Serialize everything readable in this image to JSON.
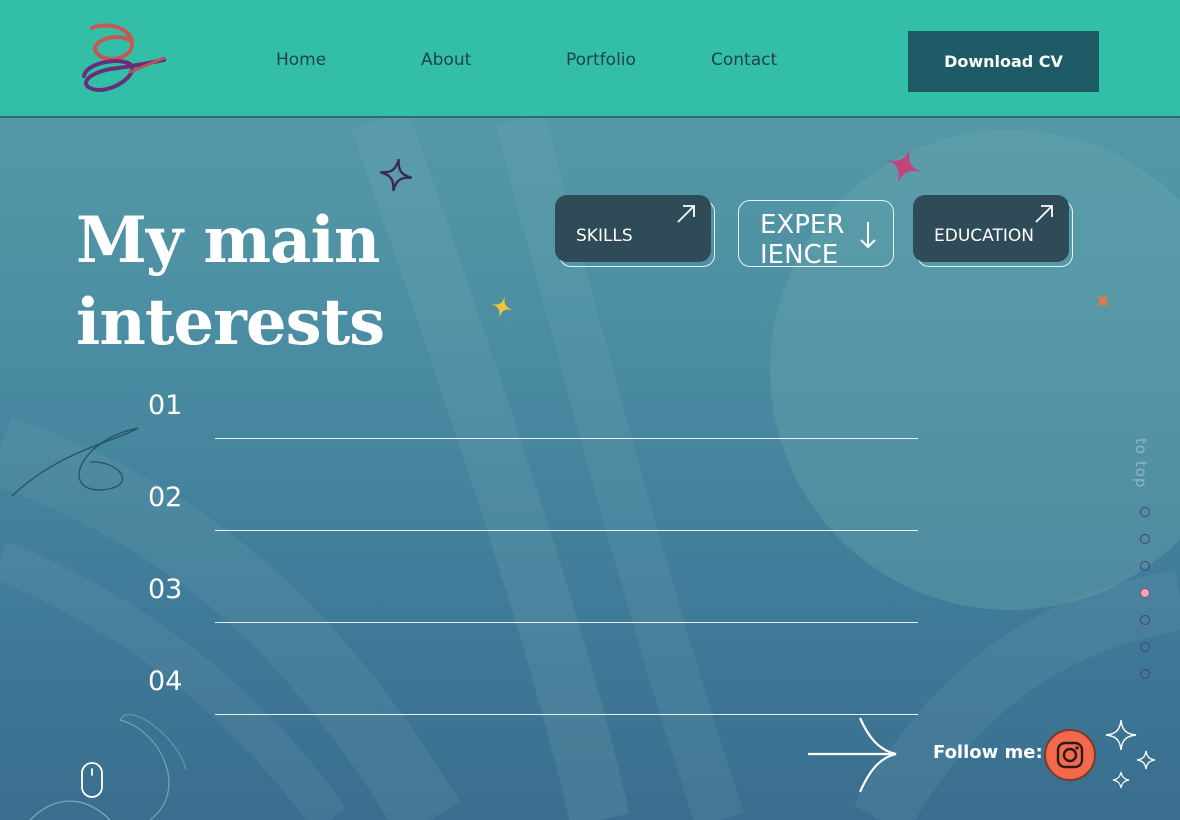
{
  "nav": {
    "logo": "logo-mark",
    "links": [
      "Home",
      "About",
      "Portfolio",
      "Contact"
    ],
    "cta_label": "Download CV"
  },
  "hero": {
    "title_line1": "My main",
    "title_line2": "interests"
  },
  "cards": [
    {
      "label": "SKILLS",
      "icon": "arrow-up-right-icon"
    },
    {
      "label_line1": "EXPER",
      "label_line2": "IENCE",
      "icon": "arrow-down-icon"
    },
    {
      "label": "EDUCATION",
      "icon": "arrow-up-right-icon"
    }
  ],
  "list": [
    "01",
    "02",
    "03",
    "04"
  ],
  "side_nav": {
    "to_top": "to top",
    "dots_total": 7,
    "active_dot": 4
  },
  "footer": {
    "follow_label": "Follow me:",
    "social_icon": "instagram-icon"
  },
  "colors": {
    "header_bg": "#33bfa7",
    "cta_bg": "#1f5a67",
    "card_fill": "#2f4b58",
    "instagram": "#f26a4b",
    "active_dot": "#f0a6ad"
  }
}
